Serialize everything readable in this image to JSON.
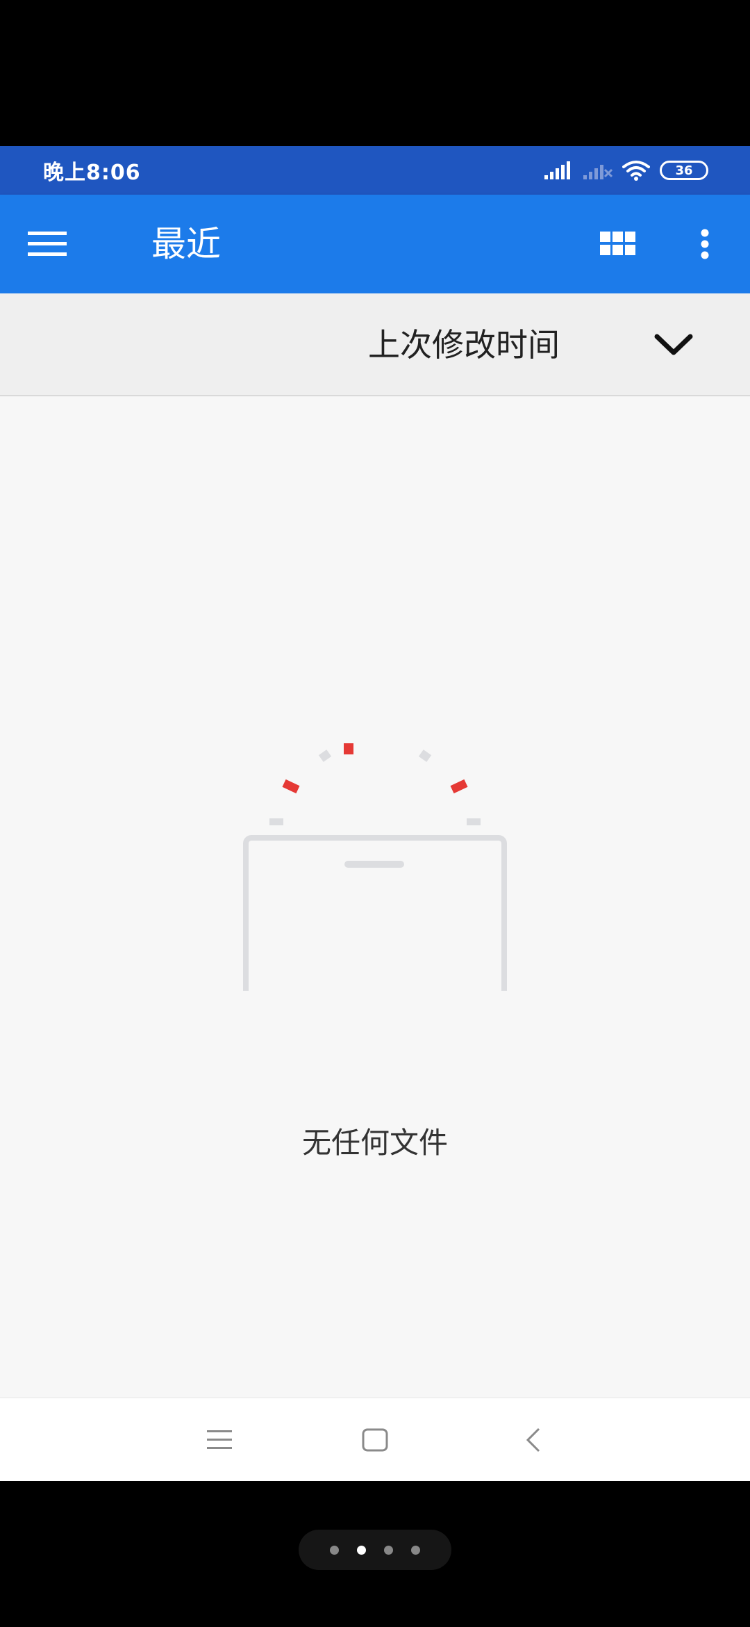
{
  "status_bar": {
    "time": "晚上8:06",
    "battery": "36",
    "icons": [
      "signal-icon",
      "signal-off-icon",
      "wifi-icon",
      "battery-icon"
    ]
  },
  "app_bar": {
    "title": "最近",
    "icons": [
      "menu-icon",
      "grid-view-icon",
      "more-vert-icon"
    ]
  },
  "sort_bar": {
    "label": "上次修改时间",
    "icon": "chevron-down-icon"
  },
  "empty_state": {
    "message": "无任何文件",
    "icon": "empty-box-icon"
  },
  "nav_bar": {
    "icons": [
      "recents-icon",
      "home-icon",
      "back-icon"
    ]
  },
  "pager": {
    "count": 4,
    "active_index": 1
  },
  "colors": {
    "status_bar": "#1f56c0",
    "app_bar": "#1c7bea",
    "sort_bar": "#efefef",
    "content": "#f7f7f7",
    "accent_red": "#e53935",
    "illustration_gray": "#dcdde0"
  }
}
